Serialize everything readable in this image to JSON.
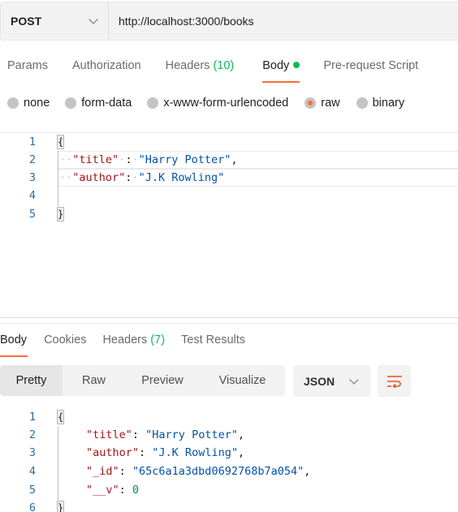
{
  "request": {
    "method": "POST",
    "url": "http://localhost:3000/books"
  },
  "request_tabs": [
    {
      "label": "Params",
      "count": null,
      "active": false
    },
    {
      "label": "Authorization",
      "count": null,
      "active": false
    },
    {
      "label": "Headers",
      "count": "(10)",
      "active": false
    },
    {
      "label": "Body",
      "count": null,
      "active": true,
      "indicator": "green-dot"
    },
    {
      "label": "Pre-request Script",
      "count": null,
      "active": false
    }
  ],
  "body_types": [
    {
      "label": "none",
      "selected": false
    },
    {
      "label": "form-data",
      "selected": false
    },
    {
      "label": "x-www-form-urlencoded",
      "selected": false
    },
    {
      "label": "raw",
      "selected": true
    },
    {
      "label": "binary",
      "selected": false
    }
  ],
  "request_body": {
    "line_numbers": [
      "1",
      "2",
      "3",
      "4",
      "5"
    ],
    "open_brace": "{",
    "close_brace": "}",
    "title_key": "\"title\"",
    "title_value": "\"Harry Potter\"",
    "author_key": "\"author\"",
    "author_value": "\"J.K Rowling\""
  },
  "response_tabs": [
    {
      "label": "Body",
      "count": null,
      "active": true
    },
    {
      "label": "Cookies",
      "count": null,
      "active": false
    },
    {
      "label": "Headers",
      "count": "(7)",
      "active": false
    },
    {
      "label": "Test Results",
      "count": null,
      "active": false
    }
  ],
  "response_views": [
    {
      "label": "Pretty",
      "active": true
    },
    {
      "label": "Raw",
      "active": false
    },
    {
      "label": "Preview",
      "active": false
    },
    {
      "label": "Visualize",
      "active": false
    }
  ],
  "response_format": "JSON",
  "response_body": {
    "line_numbers": [
      "1",
      "2",
      "3",
      "4",
      "5",
      "6"
    ],
    "open_brace": "{",
    "close_brace": "}",
    "title_key": "\"title\"",
    "title_value": "\"Harry Potter\"",
    "author_key": "\"author\"",
    "author_value": "\"J.K Rowling\"",
    "id_key": "\"_id\"",
    "id_value": "\"65c6a1a3dbd0692768b7a054\"",
    "v_key": "\"__v\"",
    "v_value": "0"
  },
  "colors": {
    "accent": "#ff6c37",
    "count_green": "#0cbb52",
    "json_key": "#a31515",
    "json_string": "#0451a5",
    "json_number": "#098658"
  }
}
